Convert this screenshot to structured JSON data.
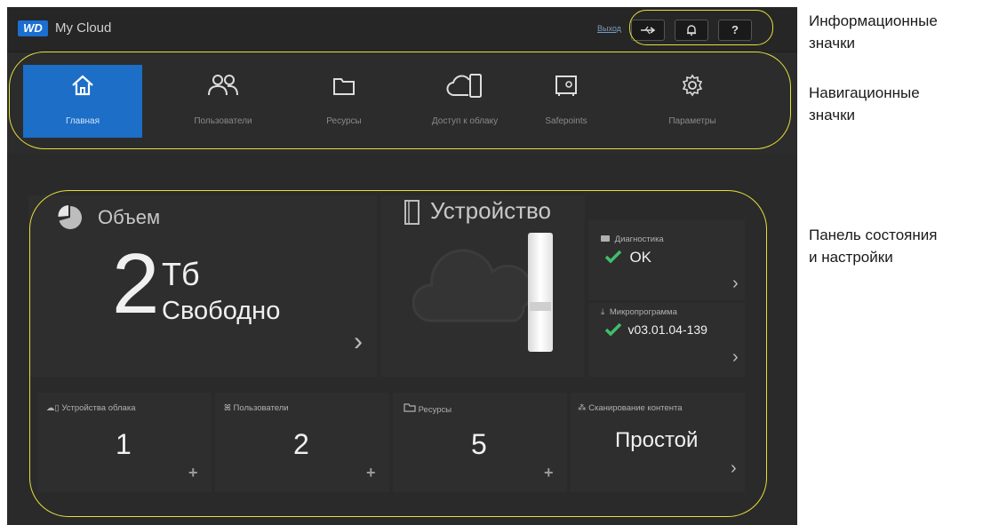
{
  "app": {
    "logo": "WD",
    "title": "My Cloud"
  },
  "header": {
    "logout": "Выход",
    "help_label": "?"
  },
  "nav": {
    "items": [
      {
        "label": "Главная",
        "icon": "home-icon"
      },
      {
        "label": "Пользователи",
        "icon": "users-icon"
      },
      {
        "label": "Ресурсы",
        "icon": "folder-icon"
      },
      {
        "label": "Доступ к облаку",
        "icon": "cloud-device-icon"
      },
      {
        "label": "Safepoints",
        "icon": "safe-icon"
      },
      {
        "label": "Параметры",
        "icon": "gear-icon"
      }
    ]
  },
  "dashboard": {
    "capacity": {
      "title": "Объем",
      "value": "2",
      "unit": "Тб",
      "caption": "Свободно"
    },
    "device": {
      "title": "Устройство",
      "diagnostics_label": "Диагностика",
      "diagnostics_value": "OK",
      "firmware_label": "Микропрограмма",
      "firmware_value": "v03.01.04-139"
    },
    "tiles": [
      {
        "label": "Устройства облака",
        "value": "1"
      },
      {
        "label": "Пользователи",
        "value": "2"
      },
      {
        "label": "Ресурсы",
        "value": "5"
      },
      {
        "label": "Сканирование контента",
        "value": "Простой"
      }
    ]
  },
  "annotations": {
    "info_icons": [
      "Информационные",
      "значки"
    ],
    "nav_icons": [
      "Навигационные",
      "значки"
    ],
    "status_panel": [
      "Панель состояния",
      "и настройки"
    ]
  },
  "colors": {
    "accent": "#1c6ec7",
    "highlight": "#e6df3a",
    "ok": "#3fbf6b"
  }
}
